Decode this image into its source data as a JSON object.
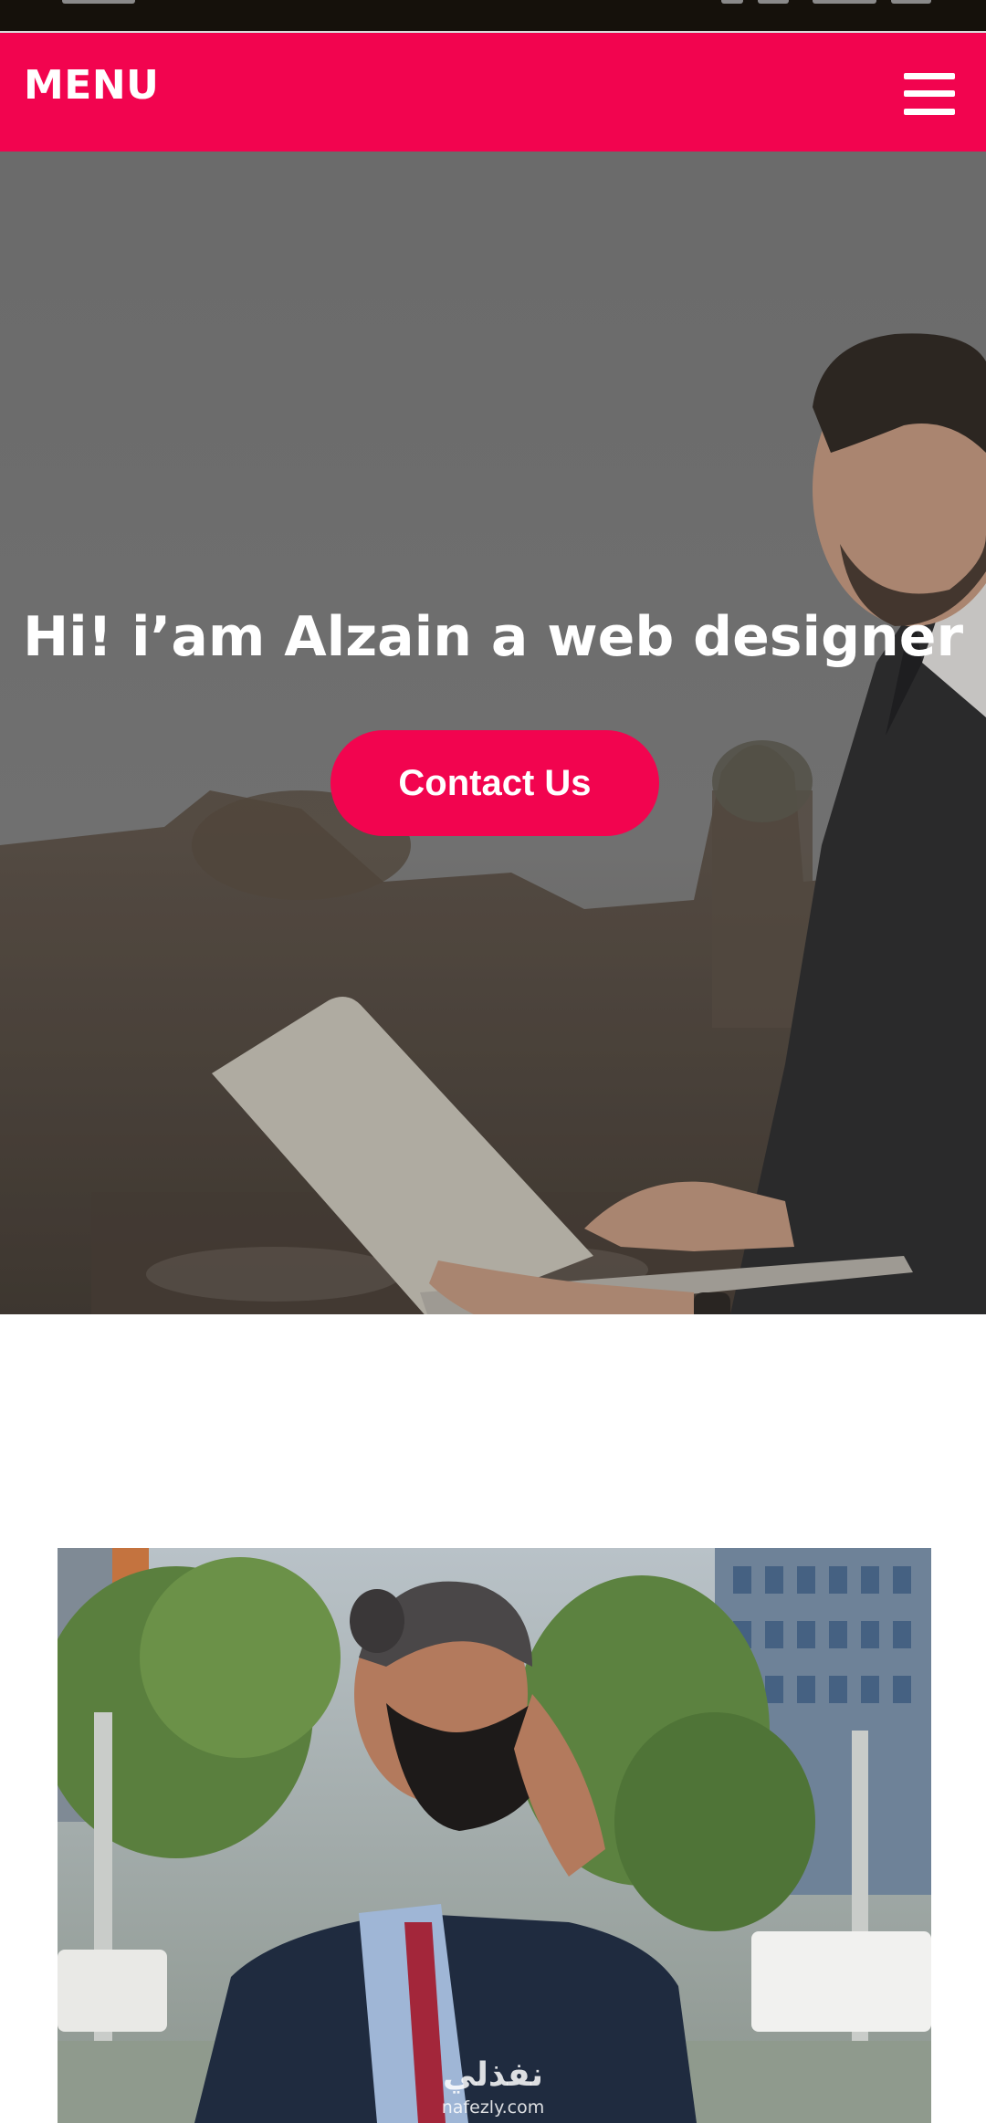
{
  "navbar": {
    "title": "MENU",
    "menu_icon": "hamburger-menu-icon",
    "background_color": "#f2044f"
  },
  "hero": {
    "title": "Hi! i’am Alzain a web designer",
    "button_label": "Contact Us",
    "button_color": "#f2044f"
  },
  "watermark": {
    "arabic": "نفذلي",
    "latin": "nafezly.com"
  }
}
